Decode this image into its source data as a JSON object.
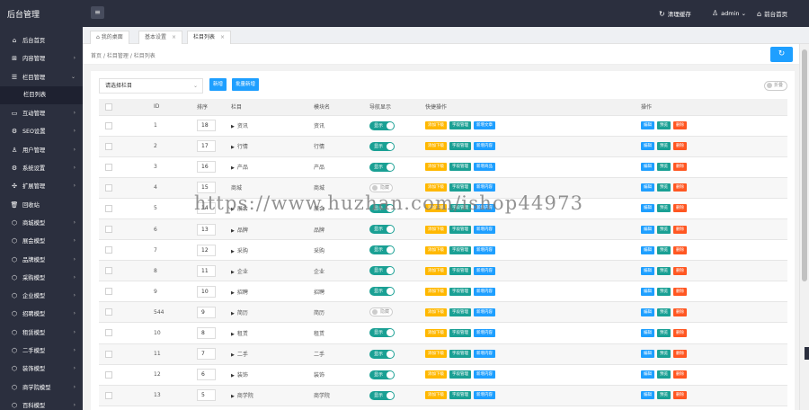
{
  "app": {
    "title": "后台管理"
  },
  "header": {
    "clear_cache": "清理缓存",
    "user": "admin",
    "home": "前台首页"
  },
  "sidebar": {
    "items": [
      {
        "label": "后台首页",
        "icon": "home-icon",
        "arrow": false
      },
      {
        "label": "内容管理",
        "icon": "grid-icon",
        "arrow": true
      },
      {
        "label": "栏目管理",
        "icon": "list-icon",
        "arrow": true,
        "expanded": true
      },
      {
        "label": "栏目列表",
        "icon": "",
        "arrow": false,
        "active": true
      },
      {
        "label": "互动管理",
        "icon": "card-icon",
        "arrow": true
      },
      {
        "label": "SEO设置",
        "icon": "gear-icon",
        "arrow": true
      },
      {
        "label": "用户管理",
        "icon": "user-icon",
        "arrow": true
      },
      {
        "label": "系统设置",
        "icon": "gear-icon",
        "arrow": true
      },
      {
        "label": "扩展管理",
        "icon": "compass-icon",
        "arrow": true
      },
      {
        "label": "回收站",
        "icon": "trash-icon",
        "arrow": false
      },
      {
        "label": "商城模型",
        "icon": "cube-icon",
        "arrow": true
      },
      {
        "label": "展会模型",
        "icon": "cube-icon",
        "arrow": true
      },
      {
        "label": "品牌模型",
        "icon": "cube-icon",
        "arrow": true
      },
      {
        "label": "采购模型",
        "icon": "cube-icon",
        "arrow": true
      },
      {
        "label": "企业模型",
        "icon": "cube-icon",
        "arrow": true
      },
      {
        "label": "招聘模型",
        "icon": "cube-icon",
        "arrow": true
      },
      {
        "label": "租赁模型",
        "icon": "cube-icon",
        "arrow": true
      },
      {
        "label": "二手模型",
        "icon": "cube-icon",
        "arrow": true
      },
      {
        "label": "装饰模型",
        "icon": "cube-icon",
        "arrow": true
      },
      {
        "label": "商学院模型",
        "icon": "cube-icon",
        "arrow": true
      },
      {
        "label": "百科模型",
        "icon": "cube-icon",
        "arrow": true
      }
    ]
  },
  "tabs": [
    {
      "label": "我的桌面",
      "closable": false
    },
    {
      "label": "基本设置",
      "closable": true
    },
    {
      "label": "栏目列表",
      "closable": true,
      "selected": true
    }
  ],
  "breadcrumb": [
    "首页",
    "栏目管理",
    "栏目列表"
  ],
  "toolbar": {
    "select_placeholder": "请选择栏目",
    "add_label": "新增",
    "batch_add_label": "批量新增",
    "fold_label": "折叠"
  },
  "table": {
    "headers": [
      "",
      "ID",
      "排序",
      "栏目",
      "模块名",
      "导航显示",
      "快捷操作",
      "操作"
    ],
    "switch_on": "显示",
    "switch_off": "隐藏",
    "quick_add_sub": "添加下级",
    "quick_field": "字段管理",
    "action_edit": "编辑",
    "action_preview": "预览",
    "action_delete": "删除",
    "rows": [
      {
        "id": "1",
        "sort": "18",
        "name": "资讯",
        "module": "资讯",
        "nav": true,
        "quick": "新增文章",
        "tri": true
      },
      {
        "id": "2",
        "sort": "17",
        "name": "行情",
        "module": "行情",
        "nav": true,
        "quick": "新增内容",
        "tri": true
      },
      {
        "id": "3",
        "sort": "16",
        "name": "产品",
        "module": "产品",
        "nav": true,
        "quick": "新增商品",
        "tri": true
      },
      {
        "id": "4",
        "sort": "15",
        "name": "商城",
        "module": "商城",
        "nav": false,
        "quick": "新增内容",
        "tri": false
      },
      {
        "id": "5",
        "sort": "14",
        "name": "展会",
        "module": "展会",
        "nav": true,
        "quick": "新增内容",
        "tri": true
      },
      {
        "id": "6",
        "sort": "13",
        "name": "品牌",
        "module": "品牌",
        "nav": true,
        "quick": "新增内容",
        "tri": true
      },
      {
        "id": "7",
        "sort": "12",
        "name": "采购",
        "module": "采购",
        "nav": true,
        "quick": "新增内容",
        "tri": true
      },
      {
        "id": "8",
        "sort": "11",
        "name": "企业",
        "module": "企业",
        "nav": true,
        "quick": "新增内容",
        "tri": true
      },
      {
        "id": "9",
        "sort": "10",
        "name": "招聘",
        "module": "招聘",
        "nav": true,
        "quick": "新增内容",
        "tri": true
      },
      {
        "id": "544",
        "sort": "9",
        "name": "简历",
        "module": "简历",
        "nav": false,
        "quick": "新增内容",
        "tri": true
      },
      {
        "id": "10",
        "sort": "8",
        "name": "租赁",
        "module": "租赁",
        "nav": true,
        "quick": "新增内容",
        "tri": true
      },
      {
        "id": "11",
        "sort": "7",
        "name": "二手",
        "module": "二手",
        "nav": true,
        "quick": "新增内容",
        "tri": true
      },
      {
        "id": "12",
        "sort": "6",
        "name": "装饰",
        "module": "装饰",
        "nav": true,
        "quick": "新增内容",
        "tri": true
      },
      {
        "id": "13",
        "sort": "5",
        "name": "商学院",
        "module": "商学院",
        "nav": true,
        "quick": "新增内容",
        "tri": true
      }
    ]
  },
  "watermark": "https://www.huzhan.com/ishop44973",
  "colors": {
    "sidebar_bg": "#2b2f3e",
    "primary_blue": "#1e9fff",
    "green": "#1aa094",
    "orange": "#ffb800",
    "red": "#ff5722"
  }
}
